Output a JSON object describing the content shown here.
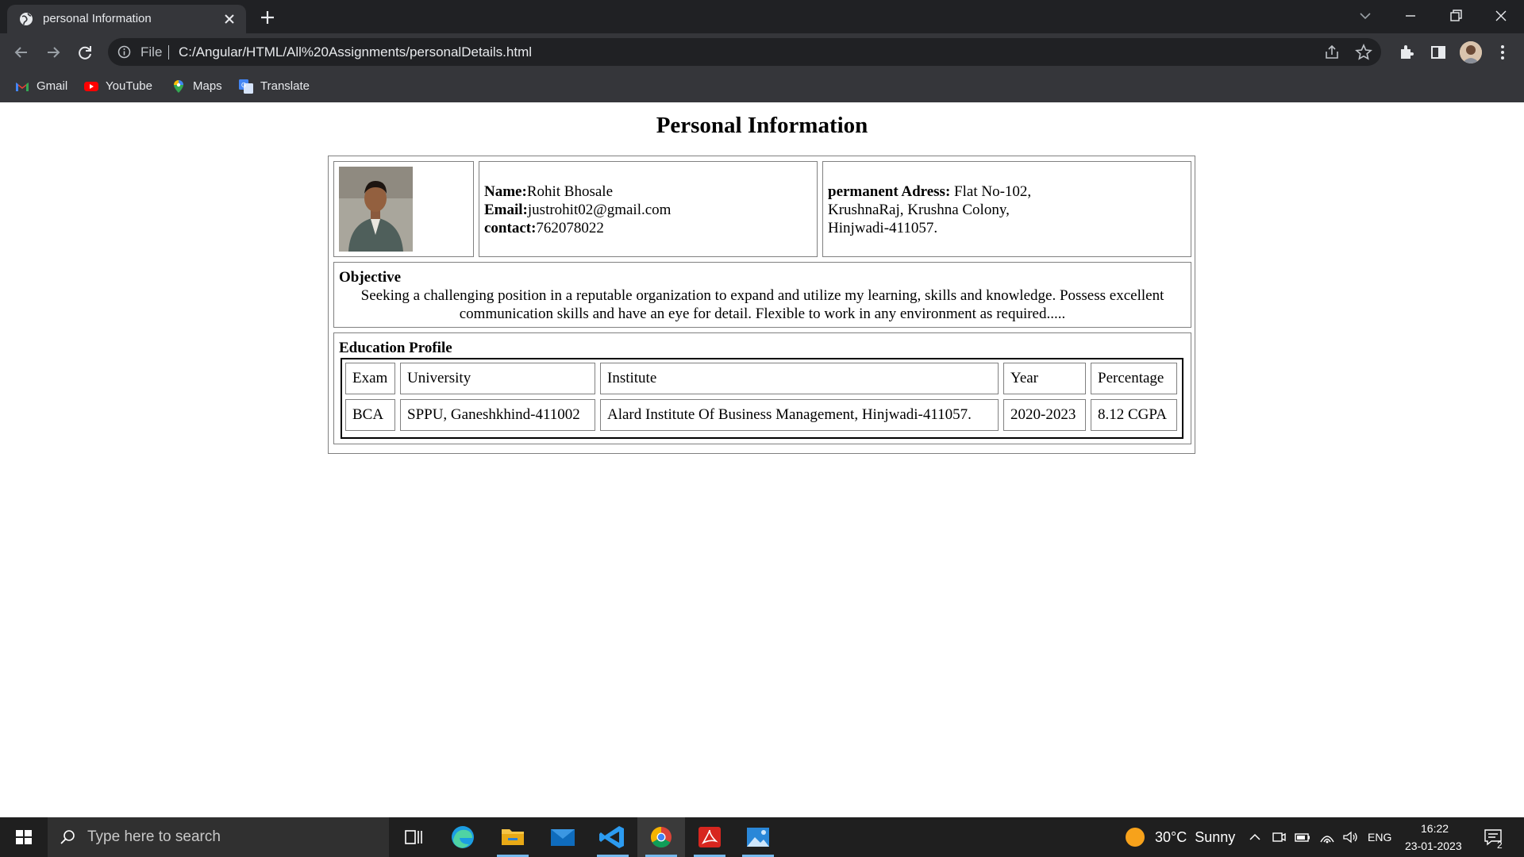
{
  "browser": {
    "tab_title": "personal Information",
    "omnibox_scheme": "File",
    "url": "C:/Angular/HTML/All%20Assignments/personalDetails.html",
    "bookmarks": [
      {
        "label": "Gmail",
        "icon": "gmail-icon"
      },
      {
        "label": "YouTube",
        "icon": "youtube-icon"
      },
      {
        "label": "Maps",
        "icon": "maps-icon"
      },
      {
        "label": "Translate",
        "icon": "translate-icon"
      }
    ]
  },
  "page": {
    "heading": "Personal Information",
    "contact": {
      "name_label": "Name:",
      "name_value": "Rohit Bhosale",
      "email_label": "Email:",
      "email_value": "justrohit02@gmail.com",
      "contact_label": "contact:",
      "contact_value": "762078022"
    },
    "address": {
      "label": "permanent Adress:",
      "line1": " Flat No-102,",
      "line2": "KrushnaRaj, Krushna Colony,",
      "line3": "Hinjwadi-411057."
    },
    "objective": {
      "heading": "Objective",
      "text": "Seeking a challenging position in a reputable organization to expand and utilize my learning, skills and knowledge. Possess excellent communication skills and have an eye for detail. Flexible to work in any environment as required....."
    },
    "education": {
      "heading": "Education Profile",
      "columns": [
        "Exam",
        "University",
        "Institute",
        "Year",
        "Percentage"
      ],
      "rows": [
        [
          "BCA",
          "SPPU, Ganeshkhind-411002",
          "Alard Institute Of Business Management, Hinjwadi-411057.",
          "2020-2023",
          "8.12 CGPA"
        ]
      ]
    }
  },
  "taskbar": {
    "search_placeholder": "Type here to search",
    "weather": "30°C  Sunny",
    "language": "ENG",
    "time": "16:22",
    "date": "23-01-2023",
    "notification_count": "2"
  },
  "colors": {
    "tabbar_bg": "#202124",
    "toolbar_bg": "#35363a",
    "taskbar_bg": "#1f1f1f",
    "accent": "#76b9ed"
  }
}
